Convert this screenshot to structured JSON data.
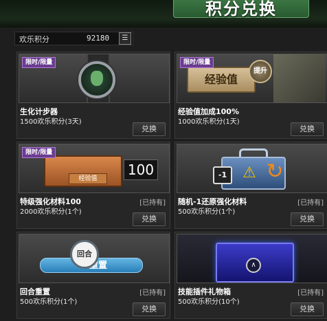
{
  "header": {
    "title": "积分兑换"
  },
  "points": {
    "label": "欢乐积分",
    "value": "92180",
    "icon": "menu-icon"
  },
  "colors": {
    "badge": "#6a3d90",
    "accent": "#3f7a46"
  },
  "items": [
    {
      "badge": "限时/限量",
      "name": "生化计步器",
      "price": "1500欢乐积分(3天)",
      "owned": "",
      "button": "兑换"
    },
    {
      "badge": "限时/限量",
      "name": "经验值加成100%",
      "price": "1000欢乐积分(1天)",
      "owned": "",
      "button": "兑换",
      "art_text": "经验值",
      "art_badge": "提升"
    },
    {
      "badge": "限时/限量",
      "name": "特级强化材料100",
      "price": "2000欢乐积分(1个)",
      "owned": "[已持有]",
      "button": "兑换",
      "art_label": "经验值",
      "art_count": "100"
    },
    {
      "badge": "",
      "name": "随机-1还原强化材料",
      "price": "500欢乐积分(1个)",
      "owned": "[已持有]",
      "button": "兑换",
      "art_minus": "-1"
    },
    {
      "badge": "",
      "name": "回合重置",
      "price": "500欢乐积分(1个)",
      "owned": "[已持有]",
      "button": "兑换",
      "art_circle": "回合",
      "art_band": "重置"
    },
    {
      "badge": "",
      "name": "技能插件礼物箱",
      "price": "500欢乐积分(10个)",
      "owned": "[已持有]",
      "button": "兑换"
    }
  ]
}
